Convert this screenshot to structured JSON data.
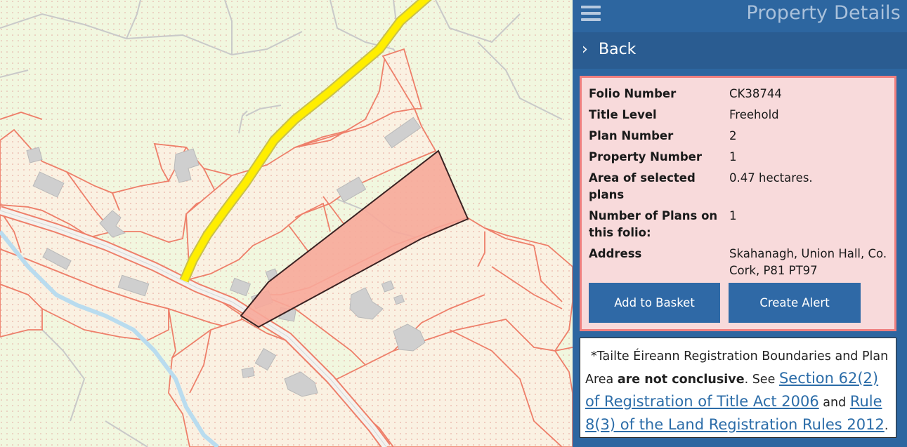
{
  "panel": {
    "title": "Property Details",
    "back_label": "Back",
    "menu_icon": "hamburger-menu-icon",
    "back_icon": "chevron-right-icon"
  },
  "details": {
    "rows": [
      {
        "label": "Folio Number",
        "value": "CK38744"
      },
      {
        "label": "Title Level",
        "value": "Freehold"
      },
      {
        "label": "Plan Number",
        "value": "2"
      },
      {
        "label": "Property Number",
        "value": "1"
      },
      {
        "label": "Area of selected plans",
        "value": "0.47 hectares."
      },
      {
        "label": "Number of Plans on this folio:",
        "value": "1"
      },
      {
        "label": "Address",
        "value": "Skahanagh, Union Hall, Co. Cork, P81 PT97"
      }
    ],
    "add_basket_label": "Add to Basket",
    "create_alert_label": "Create Alert"
  },
  "disclaimer": {
    "prefix": "*Tailte Éireann Registration Boundaries and Plan Area",
    "bold": "are not conclusive",
    "see": ". See",
    "link1": "Section 62(2) of Registration of Title Act 2006",
    "and": "and",
    "link2": "Rule 8(3) of the Land Registration Rules 2012",
    "end": "."
  },
  "colors": {
    "panel_bg": "#2d66a0",
    "back_bg": "#2a5c91",
    "button_bg": "#2f69a6",
    "details_bg": "#f8dadb",
    "details_border": "#ef7f7f",
    "map_bg": "#f1f7df",
    "parcel_fill": "#faf1e2",
    "boundary": "#ee7f6a",
    "selected_parcel": "#f7a99a",
    "road_yellow": "#ffee00",
    "building": "#cfcfcf",
    "river": "#b9dcef",
    "link": "#2b6ca8"
  }
}
